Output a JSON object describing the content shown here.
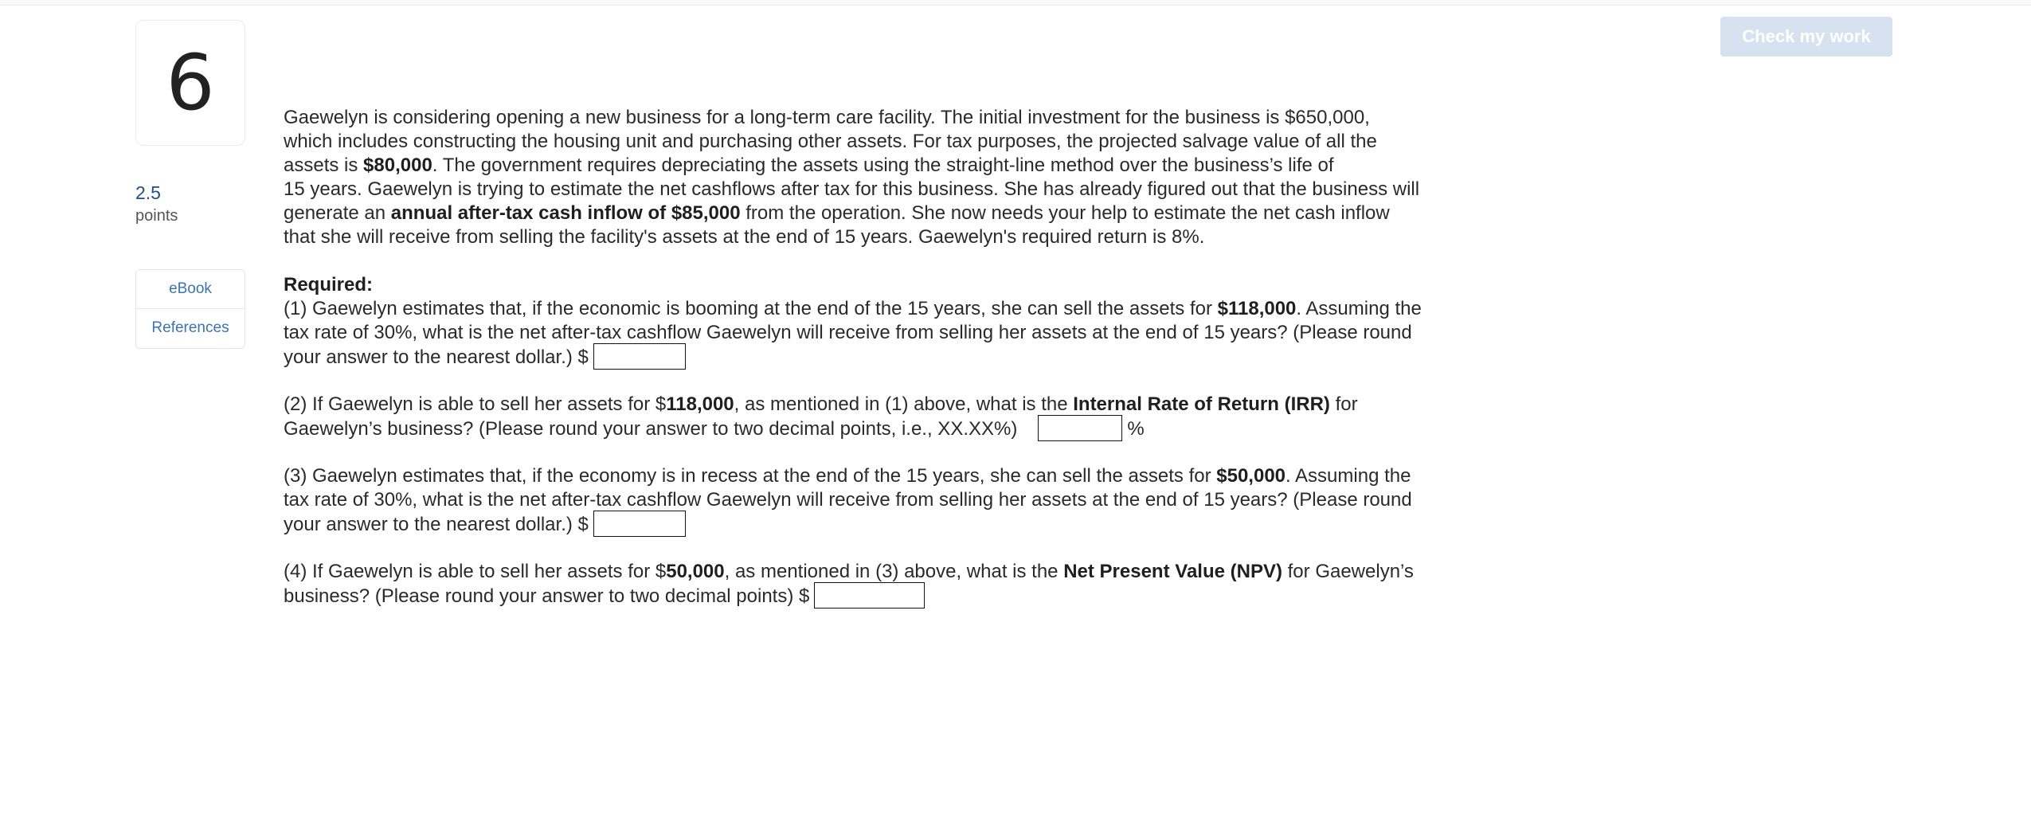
{
  "question": {
    "number": "6",
    "points_value": "2.5",
    "points_label": "points"
  },
  "resources": [
    {
      "label": "eBook"
    },
    {
      "label": "References"
    }
  ],
  "toolbar": {
    "check_label": "Check my work"
  },
  "intro": {
    "lines": [
      [
        {
          "t": "Gaewelyn is considering opening a new business for a long-term care facility. The initial investment for the business is $650,000,"
        }
      ],
      [
        {
          "t": "which includes constructing the housing unit and purchasing other assets. For tax purposes, the projected salvage value of all the"
        }
      ],
      [
        {
          "t": "assets is "
        },
        {
          "t": "$80,000",
          "b": true
        },
        {
          "t": ".  The government requires depreciating the assets using the straight-line method over the business’s life of"
        }
      ],
      [
        {
          "t": "15 years. Gaewelyn is trying to estimate the net cashflows after tax for this business. She has already figured out that the business will"
        }
      ],
      [
        {
          "t": "generate an "
        },
        {
          "t": "annual after-tax cash inflow of $85,000",
          "b": true
        },
        {
          "t": " from the operation. She now needs your help to estimate the net cash inflow"
        }
      ],
      [
        {
          "t": "that she will receive from selling the facility's assets at the end of 15 years. Gaewelyn's required return is 8%."
        }
      ]
    ]
  },
  "required_label": "Required:",
  "parts": [
    {
      "lines": [
        [
          {
            "t": "(1) Gaewelyn estimates that, if the economic is booming at the end of the 15 years, she can sell the assets for "
          },
          {
            "t": "$118,000",
            "b": true
          },
          {
            "t": ". Assuming the"
          }
        ],
        [
          {
            "t": "tax rate of 30%, what is the net after-tax cashflow Gaewelyn will receive from selling her assets at the end of 15 years? (Please round"
          }
        ],
        [
          {
            "t": "your answer to the nearest dollar.)  $"
          }
        ]
      ],
      "input_value": "",
      "unit_after": ""
    },
    {
      "lines": [
        [
          {
            "t": "(2) If Gaewelyn is able to sell her assets for $"
          },
          {
            "t": "118,000",
            "b": true
          },
          {
            "t": ", as mentioned in (1) above, what is the "
          },
          {
            "t": "Internal Rate of Return (IRR)",
            "b": true
          },
          {
            "t": " for"
          }
        ],
        [
          {
            "t": "Gaewelyn’s business?  (Please round your answer to two decimal points, i.e., XX.XX%)"
          }
        ]
      ],
      "input_value": "",
      "unit_after": "%"
    },
    {
      "lines": [
        [
          {
            "t": "(3) Gaewelyn estimates that, if the economy is in recess at the end of the 15 years, she can sell the assets for "
          },
          {
            "t": "$50,000",
            "b": true
          },
          {
            "t": ". Assuming the"
          }
        ],
        [
          {
            "t": "tax rate of 30%, what is the net after-tax cashflow Gaewelyn will receive from selling her assets at the end of 15 years? (Please round"
          }
        ],
        [
          {
            "t": "your answer to the nearest dollar.)  $"
          }
        ]
      ],
      "input_value": "",
      "unit_after": ""
    },
    {
      "lines": [
        [
          {
            "t": "(4) If Gaewelyn is able to sell her assets for $"
          },
          {
            "t": "50,000",
            "b": true
          },
          {
            "t": ", as mentioned in (3) above, what is the "
          },
          {
            "t": "Net Present Value (NPV)",
            "b": true
          },
          {
            "t": " for Gaewelyn’s"
          }
        ],
        [
          {
            "t": "business?  (Please round your answer to two decimal points)   $"
          }
        ]
      ],
      "input_value": "",
      "unit_after": ""
    }
  ]
}
